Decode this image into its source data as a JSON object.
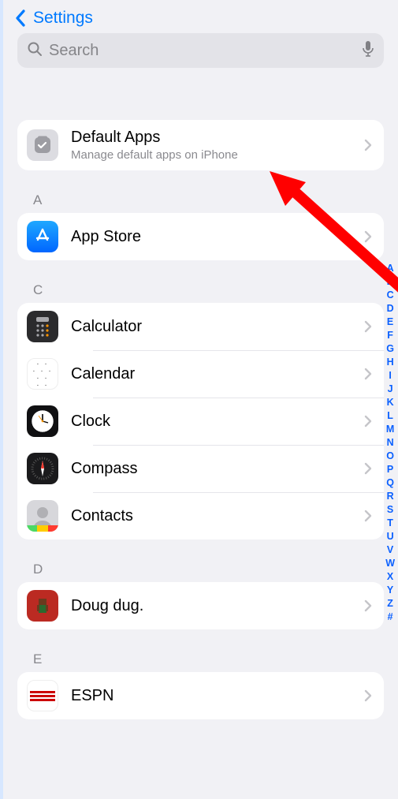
{
  "nav": {
    "back_label": "Settings"
  },
  "search": {
    "placeholder": "Search"
  },
  "default_apps": {
    "title": "Default Apps",
    "subtitle": "Manage default apps on iPhone"
  },
  "sections": {
    "a": {
      "header": "A",
      "items": {
        "app_store": "App Store"
      }
    },
    "c": {
      "header": "C",
      "items": {
        "calculator": "Calculator",
        "calendar": "Calendar",
        "clock": "Clock",
        "compass": "Compass",
        "contacts": "Contacts"
      }
    },
    "d": {
      "header": "D",
      "items": {
        "doug_dug": "Doug dug."
      }
    },
    "e": {
      "header": "E",
      "items": {
        "espn": "ESPN"
      }
    }
  },
  "alpha_index": [
    "A",
    "B",
    "C",
    "D",
    "E",
    "F",
    "G",
    "H",
    "I",
    "J",
    "K",
    "L",
    "M",
    "N",
    "O",
    "P",
    "Q",
    "R",
    "S",
    "T",
    "U",
    "V",
    "W",
    "X",
    "Y",
    "Z",
    "#"
  ]
}
